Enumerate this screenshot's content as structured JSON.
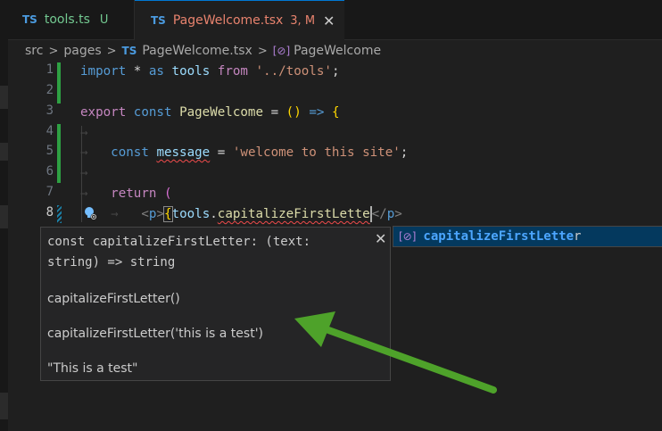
{
  "tabs": [
    {
      "icon": "TS",
      "name": "tools.ts",
      "badge": "U"
    },
    {
      "icon": "TS",
      "name": "PageWelcome.tsx",
      "badge": "3, M",
      "close": "✕"
    }
  ],
  "breadcrumb": {
    "items": [
      "src",
      "pages",
      "PageWelcome.tsx",
      "PageWelcome"
    ],
    "separator": ">",
    "file_icon": "TS",
    "symbol_icon": "symbol-variable-icon"
  },
  "line_numbers": [
    "1",
    "2",
    "3",
    "4",
    "5",
    "6",
    "7",
    "8"
  ],
  "code": {
    "l1": {
      "kw": "import",
      "star": "*",
      "as": "as",
      "name": "tools",
      "from": "from",
      "path": "'../tools'",
      "semi": ";"
    },
    "l3": {
      "kw1": "export",
      "kw2": "const",
      "name": "PageWelcome",
      "eq": "=",
      "parens": "()",
      "arrow": "=>",
      "brace": "{"
    },
    "l5": {
      "kw": "const",
      "name": "message",
      "eq": "=",
      "str": "'welcome to this site'",
      "semi": ";"
    },
    "l7": {
      "kw": "return",
      "paren": "("
    },
    "l8": {
      "open_lt": "<",
      "tag": "p",
      "open_gt": ">",
      "brace": "{",
      "obj": "tools",
      "dot": ".",
      "member": "capitalizeFirstLette",
      "close_lt": "</",
      "close_tag": "p",
      "close_gt": ">"
    },
    "tab_arrow": "→"
  },
  "hover": {
    "signature": "const capitalizeFirstLetter: (text: string) => string",
    "close": "✕",
    "doc_lines": [
      "capitalizeFirstLetter()",
      "capitalizeFirstLetter('this is a test')",
      "\"This is a test\""
    ]
  },
  "suggest": {
    "match": "capitalizeFirstLette",
    "rest": "r"
  },
  "colors": {
    "editor_bg": "#1f1f1f",
    "git_added": "#2ea043",
    "arrow": "#4ea22a",
    "suggest_selected": "#04395e"
  }
}
